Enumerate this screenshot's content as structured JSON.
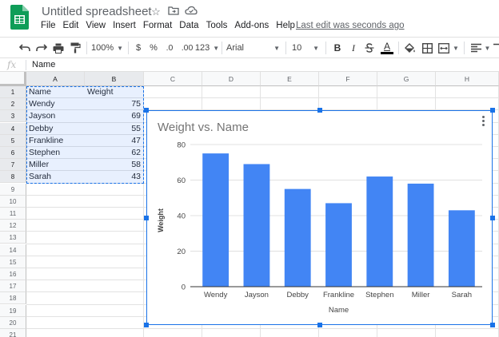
{
  "app": {
    "doc_title": "Untitled spreadsheet",
    "menus": [
      "File",
      "Edit",
      "View",
      "Insert",
      "Format",
      "Data",
      "Tools",
      "Add-ons",
      "Help"
    ],
    "last_edit": "Last edit was seconds ago"
  },
  "toolbar": {
    "zoom": "100%",
    "currency": "$",
    "percent": "%",
    "decrease_decimal": ".0",
    "increase_decimal": ".00",
    "more_formats": "123",
    "font": "Arial",
    "font_size": "10",
    "bold": "B",
    "italic": "I",
    "text_color_letter": "A"
  },
  "formula_bar": {
    "fx_label": "fx",
    "content": "Name"
  },
  "grid": {
    "columns": [
      "A",
      "B",
      "C",
      "D",
      "E",
      "F",
      "G",
      "H"
    ],
    "rows": [
      "1",
      "2",
      "3",
      "4",
      "5",
      "6",
      "7",
      "8",
      "9",
      "10",
      "11",
      "12",
      "13",
      "14",
      "15",
      "16",
      "17",
      "18",
      "19",
      "20",
      "21"
    ],
    "header": [
      "Name",
      "Weight"
    ],
    "data": [
      {
        "name": "Wendy",
        "weight": "75"
      },
      {
        "name": "Jayson",
        "weight": "69"
      },
      {
        "name": "Debby",
        "weight": "55"
      },
      {
        "name": "Frankline",
        "weight": "47"
      },
      {
        "name": "Stephen",
        "weight": "62"
      },
      {
        "name": "Miller",
        "weight": "58"
      },
      {
        "name": "Sarah",
        "weight": "43"
      }
    ]
  },
  "colors": {
    "bar": "#4285f4",
    "selection": "#1a73e8",
    "sheets_green": "#0f9d58"
  },
  "chart_data": {
    "type": "bar",
    "title": "Weight vs. Name",
    "xlabel": "Name",
    "ylabel": "Weight",
    "categories": [
      "Wendy",
      "Jayson",
      "Debby",
      "Frankline",
      "Stephen",
      "Miller",
      "Sarah"
    ],
    "values": [
      75,
      69,
      55,
      47,
      62,
      58,
      43
    ],
    "ylim": [
      0,
      80
    ],
    "yticks": [
      0,
      20,
      40,
      60,
      80
    ],
    "grid": true,
    "legend": "none"
  }
}
